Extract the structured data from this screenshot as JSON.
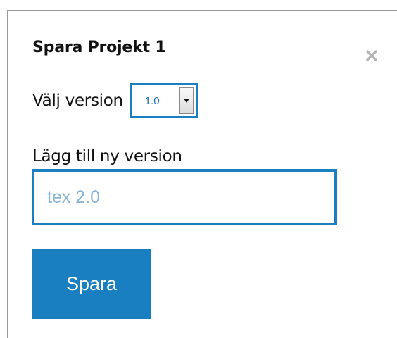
{
  "dialog": {
    "title": "Spara Projekt 1",
    "close_icon": "close-icon"
  },
  "version": {
    "label": "Välj version",
    "selected": "1.0",
    "dropdown_icon": "caret-down-icon"
  },
  "new_version": {
    "label": "Lägg till ny version",
    "value": "",
    "placeholder": "tex 2.0"
  },
  "actions": {
    "save_label": "Spara"
  },
  "colors": {
    "accent": "#1a7fc0",
    "placeholder": "#89b4d6",
    "close_icon": "#b5b5b5"
  }
}
